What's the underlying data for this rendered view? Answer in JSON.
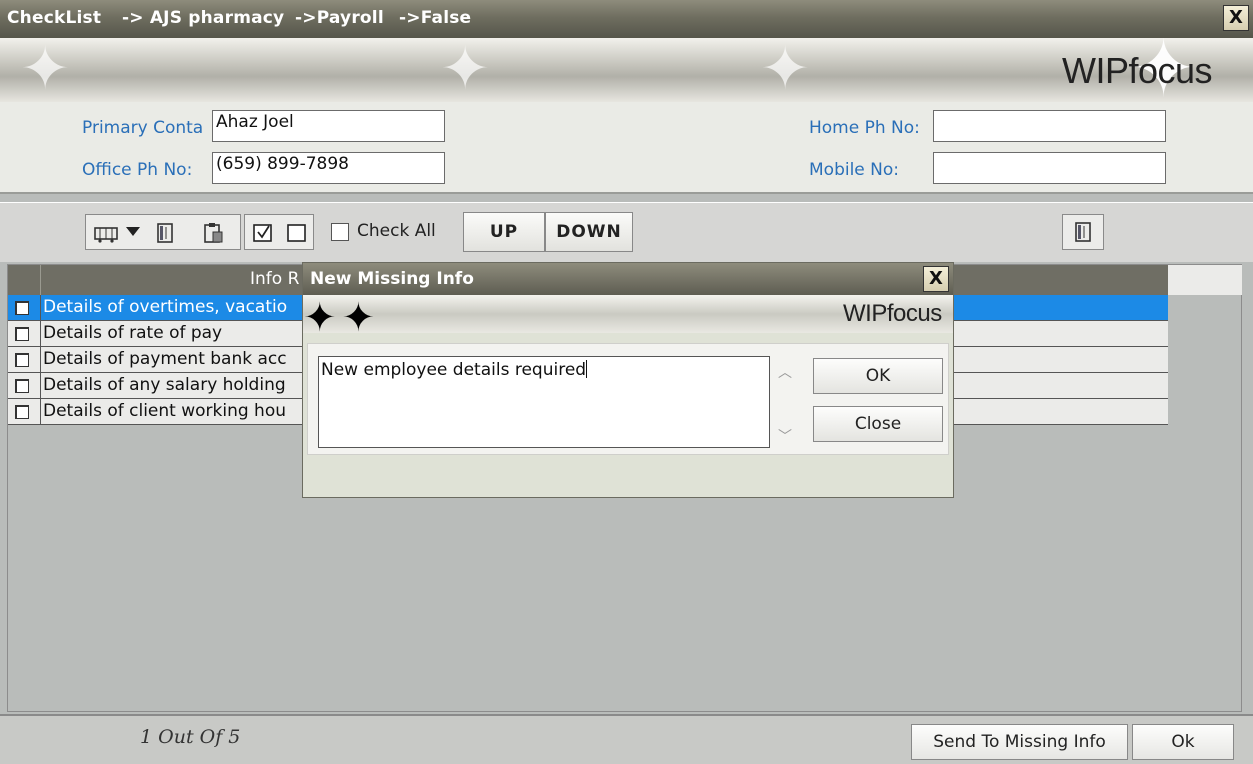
{
  "window": {
    "crumbs": [
      "CheckList",
      "-> AJS pharmacy",
      "->Payroll",
      "->False"
    ],
    "close_label": "X",
    "logo": "WIPfocus"
  },
  "contact": {
    "primary_contact_label": "Primary Conta",
    "primary_contact_value": "Ahaz Joel",
    "office_phone_label": "Office Ph No:",
    "office_phone_value": "(659) 899-7898",
    "home_phone_label": "Home Ph No:",
    "home_phone_value": "",
    "mobile_label": "Mobile No:",
    "mobile_value": ""
  },
  "toolbar": {
    "check_all_label": "Check All",
    "up_label": "UP",
    "down_label": "DOWN",
    "icons": [
      "bus-icon",
      "chevron-down-icon",
      "book-icon",
      "clipboard-icon",
      "check-box-icon",
      "empty-box-icon",
      "book-icon"
    ]
  },
  "grid": {
    "header_label": "Info R",
    "rows": [
      {
        "text": "Details of overtimes, vacatio",
        "selected": true
      },
      {
        "text": "Details of rate of pay",
        "selected": false
      },
      {
        "text": "Details of payment bank acc",
        "selected": false
      },
      {
        "text": "Details of any salary holding",
        "selected": false
      },
      {
        "text": "Details of client working hou",
        "selected": false
      }
    ]
  },
  "footer": {
    "pager": "1  Out Of    5",
    "send_label": "Send To Missing Info",
    "ok_label": "Ok"
  },
  "dialog": {
    "title": "New Missing Info",
    "close_label": "X",
    "logo": "WIPfocus",
    "text_value": "New employee details required",
    "ok_label": "OK",
    "close_button_label": "Close"
  },
  "colors": {
    "title_bar": "#6f6e60",
    "label_blue": "#2a6fb8",
    "selected_row": "#1c8ae6",
    "grid_header": "#6f6e64"
  }
}
